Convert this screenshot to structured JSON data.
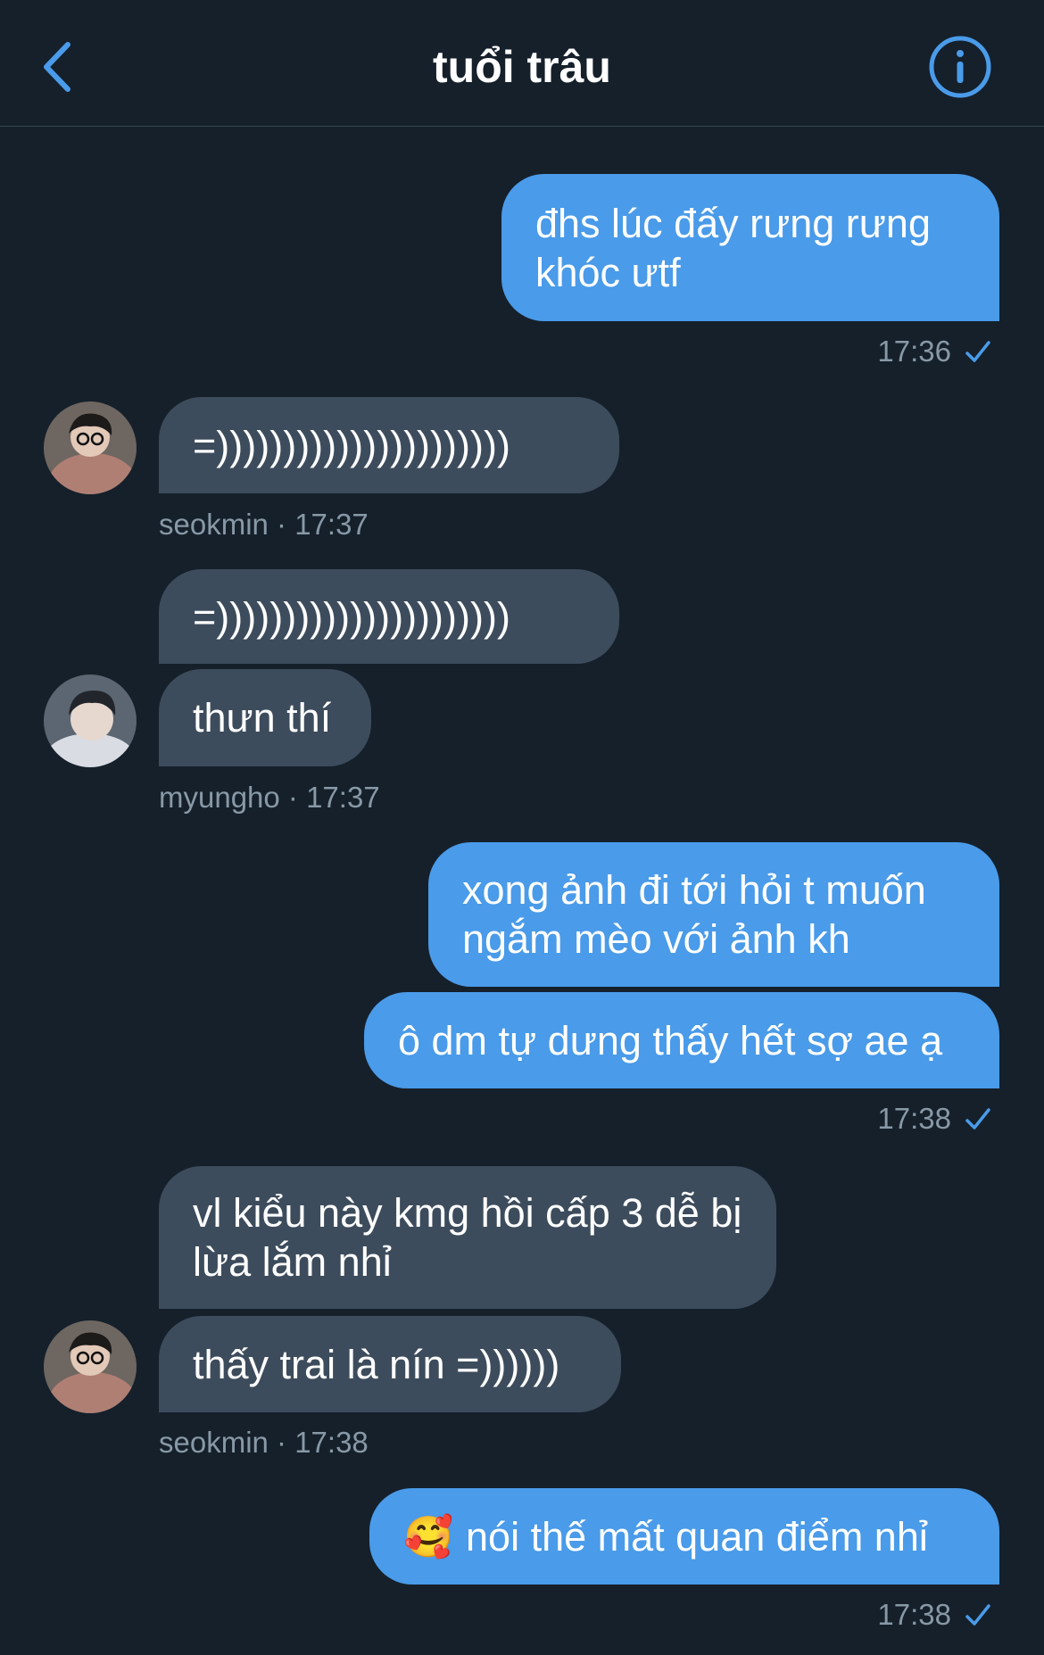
{
  "header": {
    "title": "tuổi trâu"
  },
  "messages": {
    "m1": "đhs lúc đấy rưng rưng khóc ưtf",
    "m1_time": "17:36",
    "m2": "=))))))))))))))))))))))",
    "m2_meta": "seokmin · 17:37",
    "m3": "=))))))))))))))))))))))",
    "m4": "thưn thí",
    "m4_meta": "myungho · 17:37",
    "m5": "xong ảnh đi tới hỏi t muốn ngắm mèo với ảnh kh",
    "m6": "ô dm tự dưng thấy hết sợ ae ạ",
    "m6_time": "17:38",
    "m7": "vl kiểu này kmg hồi cấp 3 dễ bị lừa lắm nhỉ",
    "m8": "thấy trai là nín =))))))",
    "m8_meta": "seokmin · 17:38",
    "m9_emoji": "🥰",
    "m9": "nói thế mất quan điểm nhỉ",
    "m9_time": "17:38"
  },
  "colors": {
    "background": "#15202b",
    "outgoing_bubble": "#4a9be9",
    "incoming_bubble": "#3d4c5c",
    "accent": "#4a9be9",
    "meta_text": "#8899a6"
  },
  "icons": [
    "back-chevron-icon",
    "info-icon",
    "check-icon",
    "avatar"
  ]
}
